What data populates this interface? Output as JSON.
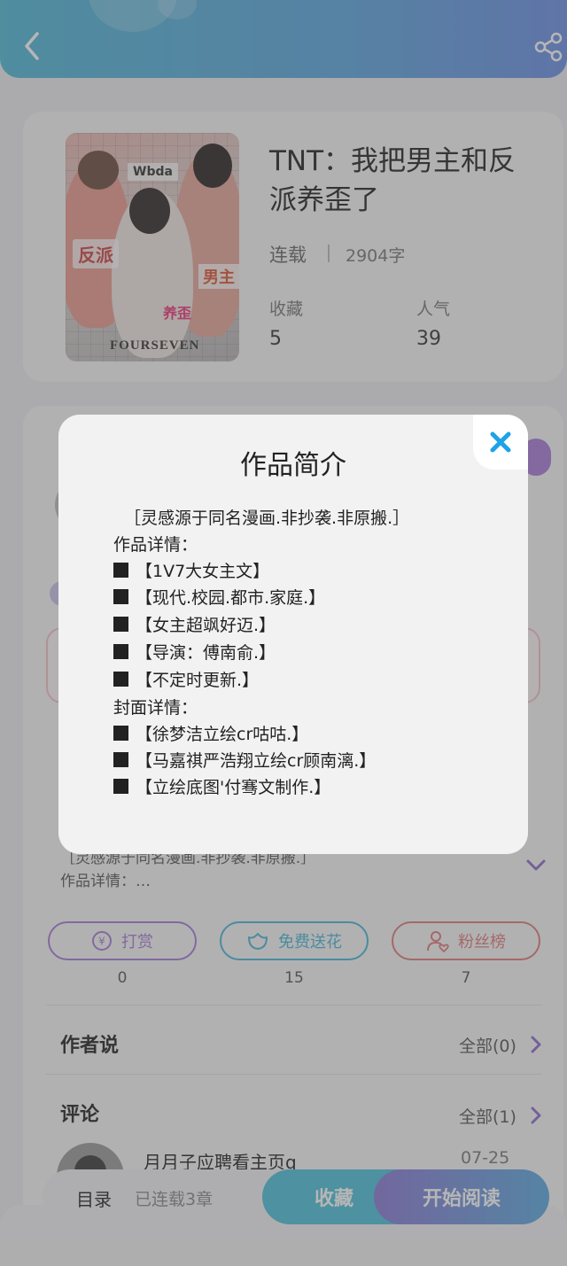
{
  "book": {
    "title": "TNT：我把男主和反派养歪了",
    "status": "连载",
    "word_count": "2904字",
    "favorites_label": "收藏",
    "favorites_value": "5",
    "popularity_label": "人气",
    "popularity_value": "39",
    "cover_text": {
      "tag1": "反派",
      "tag2": "Wbda",
      "tag3": "男主",
      "tag4": "养歪",
      "footer": "FOURSEVEN"
    }
  },
  "intro_preview": {
    "line1": "［灵感源于同名漫画.非抄袭.非原搬.］",
    "line2": "作品详情：…"
  },
  "actions": [
    {
      "label": "打赏",
      "count": "0",
      "icon": "yen-coin-icon",
      "color": "#a67bd6"
    },
    {
      "label": "免费送花",
      "count": "15",
      "icon": "flower-icon",
      "color": "#47b6d6"
    },
    {
      "label": "粉丝榜",
      "count": "7",
      "icon": "fan-user-icon",
      "color": "#e07a7a"
    }
  ],
  "author_says": {
    "title": "作者说",
    "all": "全部(0)"
  },
  "comments": {
    "title": "评论",
    "all": "全部(1)",
    "first_name": "月月子应聘看主页q",
    "first_date": "07-25"
  },
  "bottom_bar": {
    "toc": "目录",
    "serial": "已连载3章",
    "favorite": "收藏",
    "read": "开始阅读"
  },
  "modal": {
    "title": "作品简介",
    "lines": [
      "［灵感源于同名漫画.非抄袭.非原搬.］",
      "作品详情：",
      "【1V7大女主文】",
      "【现代.校园.都市.家庭.】",
      "【女主超飒好迈.】",
      "【导演：傅南俞.】",
      "【不定时更新.】",
      "封面详情：",
      "【徐梦洁立绘cr咕咕.】",
      "【马嘉祺严浩翔立绘cr顾南漓.】",
      "【立绘底图'付骞文制作.】"
    ]
  },
  "colors": {
    "header": "#4fb8d8",
    "accent_purple": "#a77bd8",
    "close_blue": "#1da3e8"
  }
}
